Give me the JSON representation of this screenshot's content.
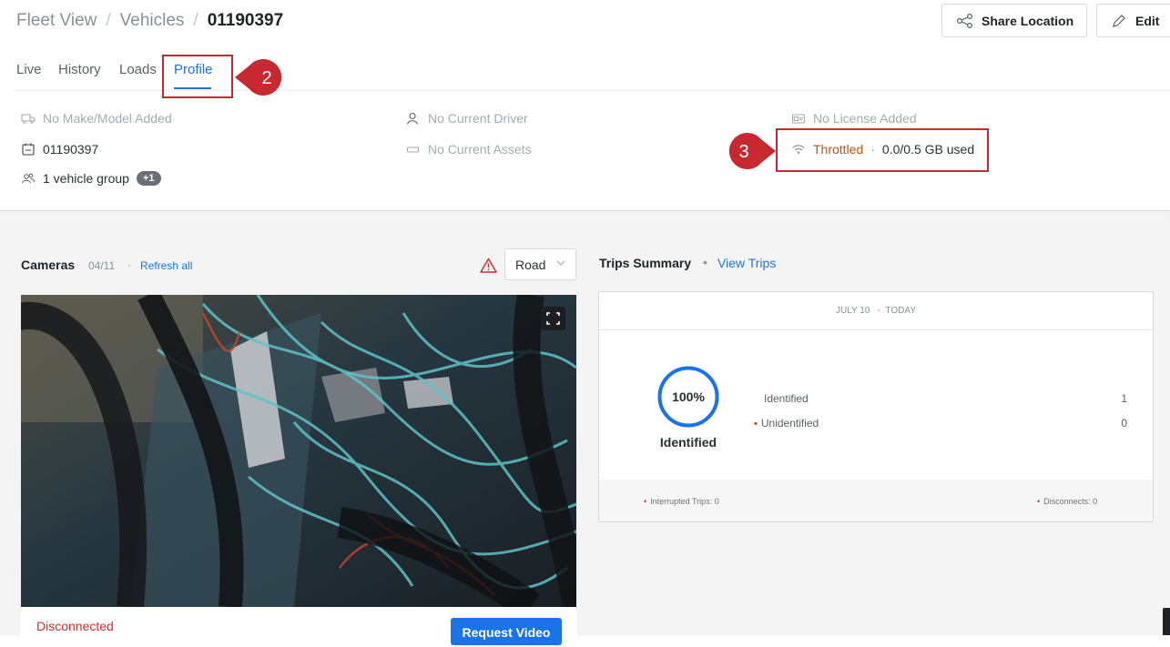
{
  "breadcrumb": {
    "root": "Fleet View",
    "parent": "Vehicles",
    "current": "01190397",
    "separator": "/"
  },
  "header_actions": {
    "share_label": "Share Location",
    "edit_label": "Edit"
  },
  "tabs": [
    {
      "label": "Live",
      "active": false
    },
    {
      "label": "History",
      "active": false
    },
    {
      "label": "Loads",
      "active": false
    },
    {
      "label": "Profile",
      "active": true
    }
  ],
  "callouts": {
    "tab_marker": "2",
    "connectivity_marker": "3",
    "color": "#c8282f"
  },
  "profile": {
    "make_model": "No Make/Model Added",
    "vehicle_id": "01190397",
    "vehicle_group": "1 vehicle group",
    "vehicle_group_extra": "+1",
    "driver": "No Current Driver",
    "assets": "No Current Assets",
    "license": "No License Added",
    "connectivity_status": "Throttled",
    "connectivity_dot": "·",
    "data_usage": "0.0/0.5 GB used"
  },
  "cameras": {
    "title": "Cameras",
    "count": "04/11",
    "dot": "·",
    "refresh_label": "Refresh all",
    "view_select": "Road",
    "status": "Disconnected",
    "request_label": "Request Video"
  },
  "trips": {
    "title": "Trips Summary",
    "dot": "•",
    "view_label": "View Trips",
    "date_range": "JULY 10   -  TODAY",
    "percent": "100%",
    "percent_label": "Identified",
    "percent_value": 1.0,
    "rows": [
      {
        "label": "Identified",
        "value": "1",
        "flag": false
      },
      {
        "label": "Unidentified",
        "value": "0",
        "flag": true
      }
    ],
    "interrupted": "Interrupted Trips: 0",
    "disconnects": "Disconnects: 0"
  },
  "colors": {
    "accent": "#1a73e8",
    "warning": "#d62c2c",
    "throttled": "#b5560c"
  }
}
